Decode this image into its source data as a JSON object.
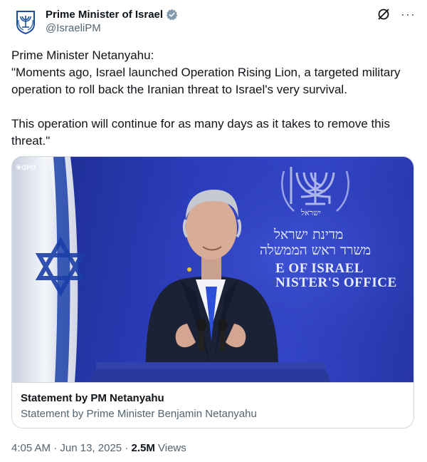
{
  "author": {
    "display_name": "Prime Minister of Israel",
    "handle": "@IsraeliPM",
    "verified_badge_color": "#829aab"
  },
  "top_icons": [
    "grok-icon",
    "more-icon"
  ],
  "more_label": "···",
  "tweet": {
    "text": "Prime Minister Netanyahu:\n\"Moments ago, Israel launched Operation Rising Lion, a targeted military operation to roll back the Iranian threat to Israel's very survival.\n\nThis operation will continue for as many days as it takes to remove this threat.\""
  },
  "media": {
    "watermark": "GPO",
    "sign_hebrew_1": "מדינת ישראל",
    "sign_hebrew_2": "משרד ראש הממשלה",
    "sign_hebrew_emblem": "ישראל",
    "sign_english_1": "E OF ISRAEL",
    "sign_english_2": "NISTER'S OFFICE",
    "card_title": "Statement by PM Netanyahu",
    "card_description": "Statement by Prime Minister Benjamin Netanyahu"
  },
  "meta": {
    "time": "4:05 AM",
    "separator": " · ",
    "date": "Jun 13, 2025",
    "separator2": " · ",
    "views_count": "2.5M",
    "views_label": " Views"
  },
  "colors": {
    "text_primary": "#0f1419",
    "text_secondary": "#536471",
    "border": "#cfd9de",
    "background_blue": "#2a3cb8"
  }
}
